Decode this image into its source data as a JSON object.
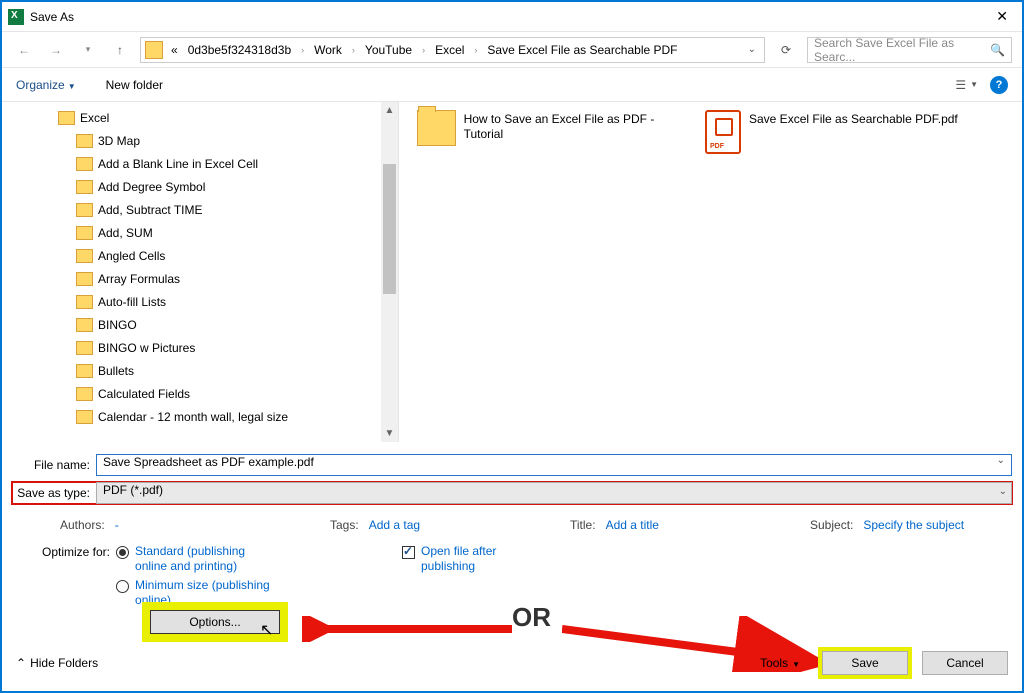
{
  "title": "Save As",
  "breadcrumb": {
    "prefix": "«",
    "p1": "0d3be5f324318d3b",
    "p2": "Work",
    "p3": "YouTube",
    "p4": "Excel",
    "p5": "Save Excel File as Searchable PDF"
  },
  "search_placeholder": "Search Save Excel File as Searc...",
  "toolbar": {
    "organize": "Organize",
    "newfolder": "New folder"
  },
  "tree": {
    "root": "Excel",
    "items": [
      "3D Map",
      "Add a Blank Line in Excel Cell",
      "Add Degree Symbol",
      "Add, Subtract TIME",
      "Add, SUM",
      "Angled Cells",
      "Array Formulas",
      "Auto-fill Lists",
      "BINGO",
      "BINGO w Pictures",
      "Bullets",
      "Calculated Fields",
      "Calendar - 12 month wall, legal size"
    ]
  },
  "files": {
    "f1": "How to Save an Excel File as PDF - Tutorial",
    "f2": "Save Excel File as Searchable PDF.pdf"
  },
  "form": {
    "filename_label": "File name:",
    "filename_value": "Save Spreadsheet as PDF example.pdf",
    "savetype_label": "Save as type:",
    "savetype_value": "PDF (*.pdf)"
  },
  "meta": {
    "authors_label": "Authors:",
    "authors_value": "-",
    "tags_label": "Tags:",
    "tags_value": "Add a tag",
    "title_label": "Title:",
    "title_value": "Add a title",
    "subject_label": "Subject:",
    "subject_value": "Specify the subject"
  },
  "opts": {
    "optimize_label": "Optimize for:",
    "standard": "Standard (publishing online and printing)",
    "minimum": "Minimum size (publishing online)",
    "openafter": "Open file after publishing",
    "options_btn": "Options..."
  },
  "footer": {
    "hide": "Hide Folders",
    "tools": "Tools",
    "save": "Save",
    "cancel": "Cancel"
  },
  "or_text": "OR"
}
